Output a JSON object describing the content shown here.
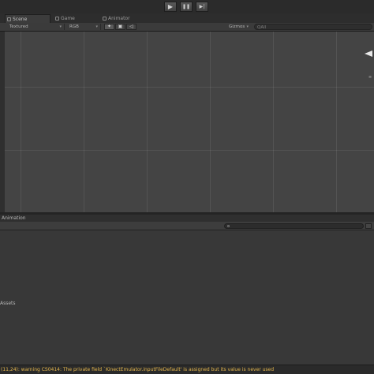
{
  "toolbar": {
    "play_icon": "▶",
    "pause_icon": "❚❚",
    "step_icon": "▶|"
  },
  "tabs": [
    {
      "label": "Scene",
      "icon": "scene-icon"
    },
    {
      "label": "Game",
      "icon": "game-icon"
    },
    {
      "label": "Animator",
      "icon": "animator-icon"
    }
  ],
  "scene_bar": {
    "shading_mode": "Textured",
    "render_mode": "RGB",
    "gizmos_label": "Gizmos",
    "search_placeholder": "QAll"
  },
  "lower_panel": {
    "tab_label": "Animation",
    "assets_label": "Assets"
  },
  "status_bar": {
    "message": "(11,24): warning CS0414: The private field `KinectEmulator.inputFileDefault' is assigned but its value is never used"
  },
  "colors": {
    "background": "#3a3a3a",
    "scene_bg": "#444444",
    "warning_text": "#e6b84e"
  }
}
